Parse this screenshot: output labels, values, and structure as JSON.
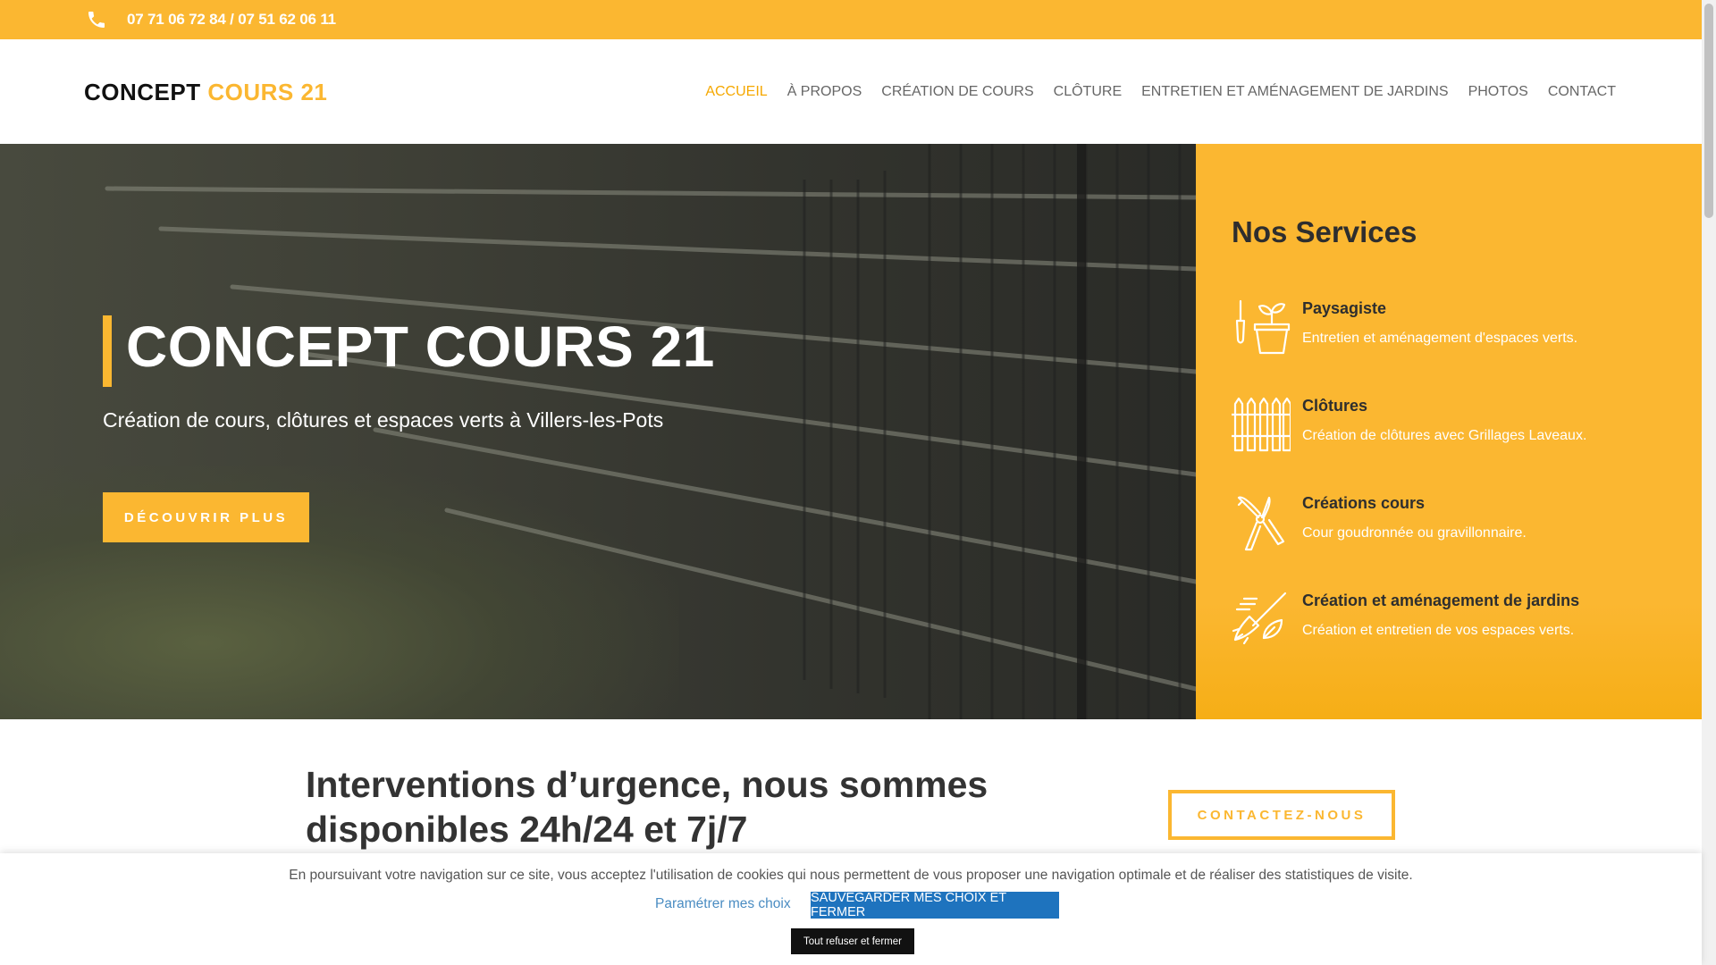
{
  "topbar": {
    "phones": "07 71 06 72 84 / 07 51 62 06 11",
    "icon": "phone-icon"
  },
  "header": {
    "logo_main": "CONCEPT ",
    "logo_accent": "COURS 21",
    "nav": [
      {
        "label": "ACCUEIL",
        "active": true
      },
      {
        "label": "À PROPOS"
      },
      {
        "label": "CRÉATION DE COURS"
      },
      {
        "label": "CLÔTURE"
      },
      {
        "label": "ENTRETIEN ET AMÉNAGEMENT DE JARDINS"
      },
      {
        "label": "PHOTOS"
      },
      {
        "label": "CONTACT"
      }
    ]
  },
  "hero": {
    "title": "CONCEPT COURS 21",
    "subtitle": "Création de cours, clôtures et espaces verts à Villers-les-Pots",
    "cta": "DÉCOUVRIR PLUS"
  },
  "services": {
    "heading": "Nos Services",
    "items": [
      {
        "title": "Paysagiste",
        "desc": "Entretien et aménagement d'espaces verts.",
        "icon": "gardening-tools-icon"
      },
      {
        "title": "Clôtures",
        "desc": "Création de clôtures avec Grillages Laveaux.",
        "icon": "fence-icon"
      },
      {
        "title": "Créations cours",
        "desc": "Cour goudronnée ou gravillonnaire.",
        "icon": "pruning-shears-icon"
      },
      {
        "title": "Création et aménagement de jardins",
        "desc": "Création et entretien de vos espaces verts.",
        "icon": "rake-leaf-icon"
      }
    ]
  },
  "urgency": {
    "heading": "Interventions d’urgence, nous sommes disponibles 24h/24 et 7j/7",
    "button": "CONTACTEZ-NOUS"
  },
  "cookie": {
    "message": "En poursuivant votre navigation sur ce site, vous acceptez l'utilisation de cookies qui nous permettent de vous proposer une navigation optimale et de réaliser des statistiques de visite.",
    "settings_link": "Paramétrer mes choix",
    "save_button": "SAUVEGARDER MES CHOIX ET FERMER",
    "refuse_button": "Tout refuser et fermer"
  },
  "colors": {
    "accent": "#fbb731",
    "nav_active": "#f5a800",
    "cookie_button": "#1e73be"
  }
}
